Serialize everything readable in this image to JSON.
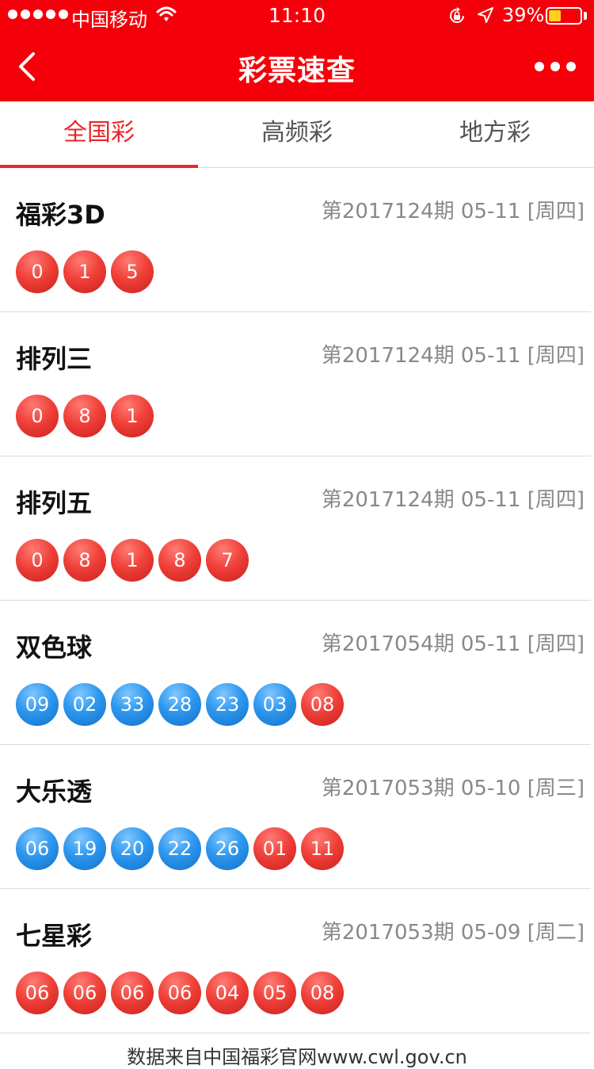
{
  "status_bar": {
    "carrier": "中国移动",
    "time": "11:10",
    "battery_percent": "39%",
    "battery_level": 0.39
  },
  "header": {
    "title": "彩票速查",
    "background_color": "#f5000a"
  },
  "tabs": [
    {
      "label": "全国彩",
      "active": true
    },
    {
      "label": "高频彩",
      "active": false
    },
    {
      "label": "地方彩",
      "active": false
    }
  ],
  "lotteries": [
    {
      "name": "福彩3D",
      "issue": "第2017124期 05-11 [周四]",
      "balls": [
        {
          "n": "0",
          "color": "red"
        },
        {
          "n": "1",
          "color": "red"
        },
        {
          "n": "5",
          "color": "red"
        }
      ]
    },
    {
      "name": "排列三",
      "issue": "第2017124期 05-11 [周四]",
      "balls": [
        {
          "n": "0",
          "color": "red"
        },
        {
          "n": "8",
          "color": "red"
        },
        {
          "n": "1",
          "color": "red"
        }
      ]
    },
    {
      "name": "排列五",
      "issue": "第2017124期 05-11 [周四]",
      "balls": [
        {
          "n": "0",
          "color": "red"
        },
        {
          "n": "8",
          "color": "red"
        },
        {
          "n": "1",
          "color": "red"
        },
        {
          "n": "8",
          "color": "red"
        },
        {
          "n": "7",
          "color": "red"
        }
      ]
    },
    {
      "name": "双色球",
      "issue": "第2017054期 05-11 [周四]",
      "balls": [
        {
          "n": "09",
          "color": "blue"
        },
        {
          "n": "02",
          "color": "blue"
        },
        {
          "n": "33",
          "color": "blue"
        },
        {
          "n": "28",
          "color": "blue"
        },
        {
          "n": "23",
          "color": "blue"
        },
        {
          "n": "03",
          "color": "blue"
        },
        {
          "n": "08",
          "color": "red"
        }
      ]
    },
    {
      "name": "大乐透",
      "issue": "第2017053期 05-10 [周三]",
      "balls": [
        {
          "n": "06",
          "color": "blue"
        },
        {
          "n": "19",
          "color": "blue"
        },
        {
          "n": "20",
          "color": "blue"
        },
        {
          "n": "22",
          "color": "blue"
        },
        {
          "n": "26",
          "color": "blue"
        },
        {
          "n": "01",
          "color": "red"
        },
        {
          "n": "11",
          "color": "red"
        }
      ]
    },
    {
      "name": "七星彩",
      "issue": "第2017053期 05-09 [周二]",
      "balls": [
        {
          "n": "06",
          "color": "red"
        },
        {
          "n": "06",
          "color": "red"
        },
        {
          "n": "06",
          "color": "red"
        },
        {
          "n": "06",
          "color": "red"
        },
        {
          "n": "04",
          "color": "red"
        },
        {
          "n": "05",
          "color": "red"
        },
        {
          "n": "08",
          "color": "red"
        }
      ]
    }
  ],
  "footer": {
    "source": "数据来自中国福彩官网www.cwl.gov.cn"
  },
  "icons": [
    "signal-icon",
    "wifi-icon",
    "orientation-lock-icon",
    "location-arrow-icon",
    "battery-icon",
    "back-arrow-icon",
    "more-dots-icon"
  ]
}
